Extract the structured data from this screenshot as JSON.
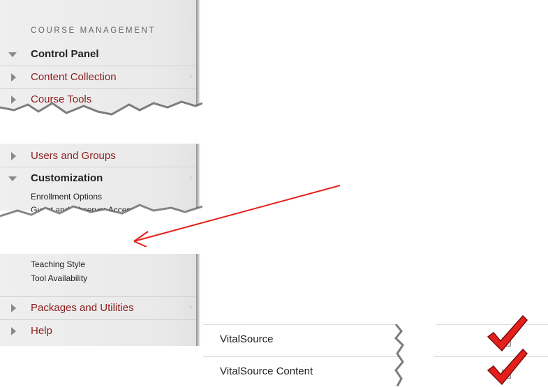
{
  "course_management": {
    "section_label": "COURSE MANAGEMENT",
    "control_panel": "Control Panel",
    "items": {
      "content_collection": "Content Collection",
      "course_tools": "Course Tools",
      "users_and_groups": "Users and Groups",
      "customization": "Customization",
      "packages_and_utilities": "Packages and Utilities",
      "help": "Help"
    },
    "customization_sub": {
      "enrollment_options": "Enrollment Options",
      "guest_access": "Guest and Observer Access",
      "teaching_style": "Teaching Style",
      "tool_availability": "Tool Availability"
    }
  },
  "tool_list": {
    "rows": [
      {
        "label": "VitalSource",
        "checked": true
      },
      {
        "label": "VitalSource Content",
        "checked": true
      }
    ]
  },
  "colors": {
    "link_red": "#8b1c1c",
    "annotation_red": "#e5201c"
  },
  "icons": [
    "collapse-arrow-icon",
    "expand-arrow-icon",
    "chevron-right-icon",
    "checkmark-icon",
    "annotation-arrow-icon"
  ]
}
